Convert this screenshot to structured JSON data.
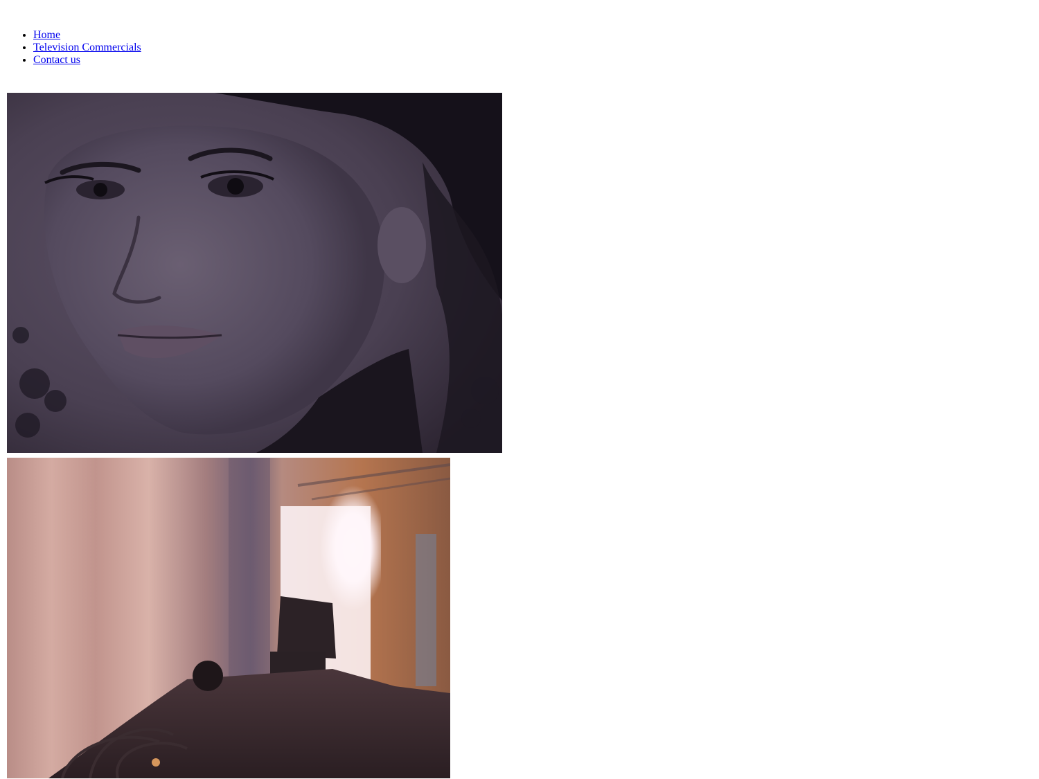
{
  "nav": {
    "items": [
      {
        "label": "Home"
      },
      {
        "label": "Television Commercials"
      },
      {
        "label": "Contact us"
      }
    ]
  },
  "images": [
    {
      "name": "portrait-photo",
      "icon": "portrait-image"
    },
    {
      "name": "camera-photo",
      "icon": "camera-image"
    }
  ],
  "colors": {
    "link": "#0000ee",
    "portrait_tint": "#4a4052",
    "camera_warm": "#c49088"
  }
}
